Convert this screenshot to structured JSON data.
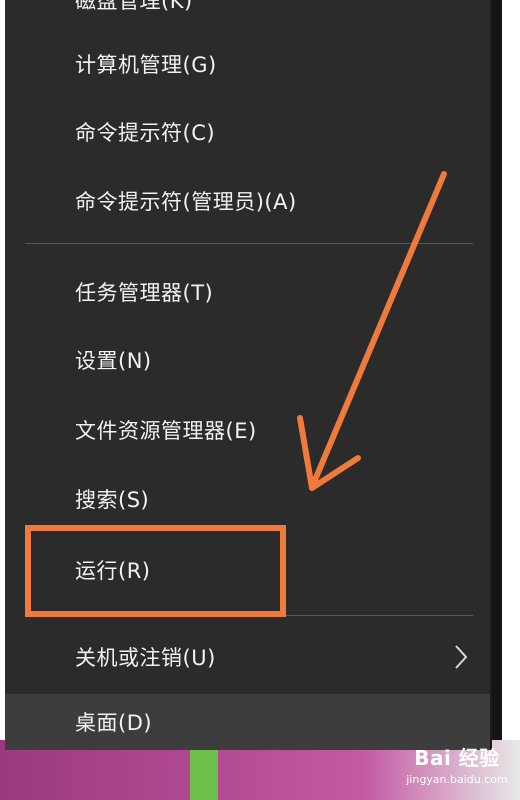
{
  "menu": {
    "items": [
      {
        "label": "磁盘管理(K)"
      },
      {
        "label": "计算机管理(G)"
      },
      {
        "label": "命令提示符(C)"
      },
      {
        "label": "命令提示符(管理员)(A)"
      },
      {
        "label": "任务管理器(T)"
      },
      {
        "label": "设置(N)"
      },
      {
        "label": "文件资源管理器(E)"
      },
      {
        "label": "搜索(S)"
      },
      {
        "label": "运行(R)"
      },
      {
        "label": "关机或注销(U)"
      },
      {
        "label": "桌面(D)"
      }
    ],
    "submenu_icon": "chevron-right-icon"
  },
  "watermark": {
    "logo": "Bai 经验",
    "url": "jingyan.baidu.com"
  },
  "colors": {
    "menu_bg": "#2b2b2b",
    "annotation": "#f07a3c"
  }
}
